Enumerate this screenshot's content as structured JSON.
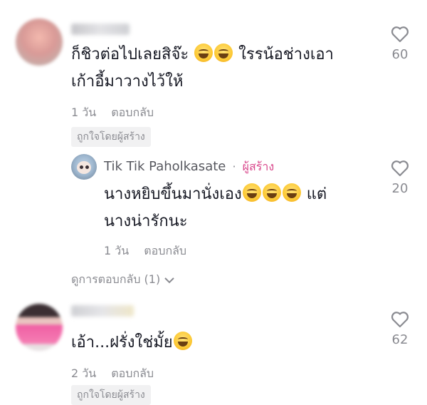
{
  "comments": [
    {
      "text_line1": "ก็ชิวต่อไปเลยสิจ๊ะ",
      "text_line1_after": "ใรรน้อช่างเอา",
      "text_line2": "เก้าอี้มาวางไว้ให้",
      "emoji_count": 2,
      "time": "1 วัน",
      "reply_label": "ตอบกลับ",
      "liked_by_creator": "ถูกใจโดยผู้สร้าง",
      "likes": "60"
    },
    {
      "author": "Tik Tik Paholkasate",
      "separator": "·",
      "creator_tag": "ผู้สร้าง",
      "text_line1": "นางหยิบขึ้นมานั่งเอง",
      "text_line1_after": "แต่",
      "text_line2": "นางน่ารักนะ",
      "emoji_count": 3,
      "time": "1 วัน",
      "reply_label": "ตอบกลับ",
      "likes": "20"
    },
    {
      "text_line1": "เอ้า...ฝรั่งใช่มั้ย",
      "emoji_count": 1,
      "time": "2 วัน",
      "reply_label": "ตอบกลับ",
      "liked_by_creator": "ถูกใจโดยผู้สร้าง",
      "likes": "62"
    }
  ],
  "view_replies": "ดูการตอบกลับ (1)",
  "icons": {
    "like": "heart-outline-icon",
    "expand": "chevron-down-icon",
    "emoji": "grinning-sweat-emoji-icon"
  },
  "colors": {
    "text": "#161823",
    "muted": "#8a8b91",
    "creator": "#d9488c",
    "badge_bg": "#f1f1f2"
  }
}
